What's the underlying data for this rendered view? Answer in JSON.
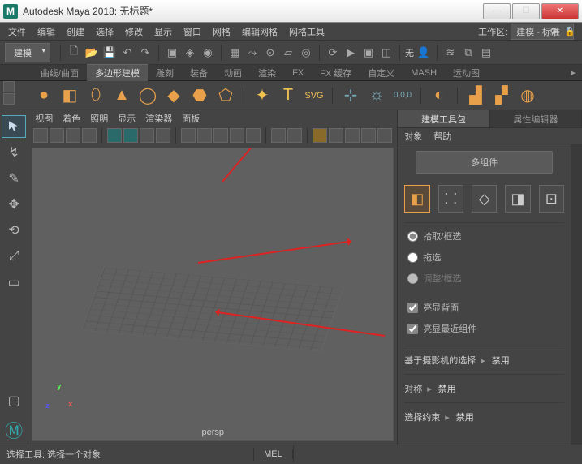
{
  "titlebar": {
    "app_prefix": "M",
    "title": "Autodesk Maya 2018: 无标题*"
  },
  "menubar": {
    "items": [
      "文件",
      "编辑",
      "创建",
      "选择",
      "修改",
      "显示",
      "窗口",
      "网格",
      "编辑网格",
      "网格工具"
    ],
    "workspace_label": "工作区:",
    "workspace_value": "建模 - 标准"
  },
  "toolbar": {
    "mode": "建模",
    "no_label": "无"
  },
  "shelf": {
    "tabs": [
      "曲线/曲面",
      "多边形建模",
      "雕刻",
      "装备",
      "动画",
      "渲染",
      "FX",
      "FX 缓存",
      "自定义",
      "MASH",
      "运动图"
    ],
    "active_tab": 1
  },
  "leftTools": [
    "select",
    "lasso",
    "brush",
    "move",
    "rotate",
    "scale",
    "last"
  ],
  "viewport": {
    "menus": [
      "视图",
      "着色",
      "照明",
      "显示",
      "渲染器",
      "面板"
    ],
    "camera": "persp"
  },
  "rightpanel": {
    "tabs": [
      "建模工具包",
      "属性编辑器"
    ],
    "active_tab": 0,
    "submenu": [
      "对象",
      "帮助"
    ],
    "multi_component": "多组件",
    "radios": {
      "pick_marquee": "拾取/框选",
      "drag": "拖选",
      "tweak": "调整/框选"
    },
    "checks": {
      "highlight_back": "亮显背面",
      "highlight_nearest": "亮显最近组件"
    },
    "camera_sel_label": "基于摄影机的选择",
    "symmetry_label": "对称",
    "constraint_label": "选择约束",
    "disable": "禁用"
  },
  "status": {
    "msg": "选择工具: 选择一个对象",
    "mel": "MEL"
  }
}
